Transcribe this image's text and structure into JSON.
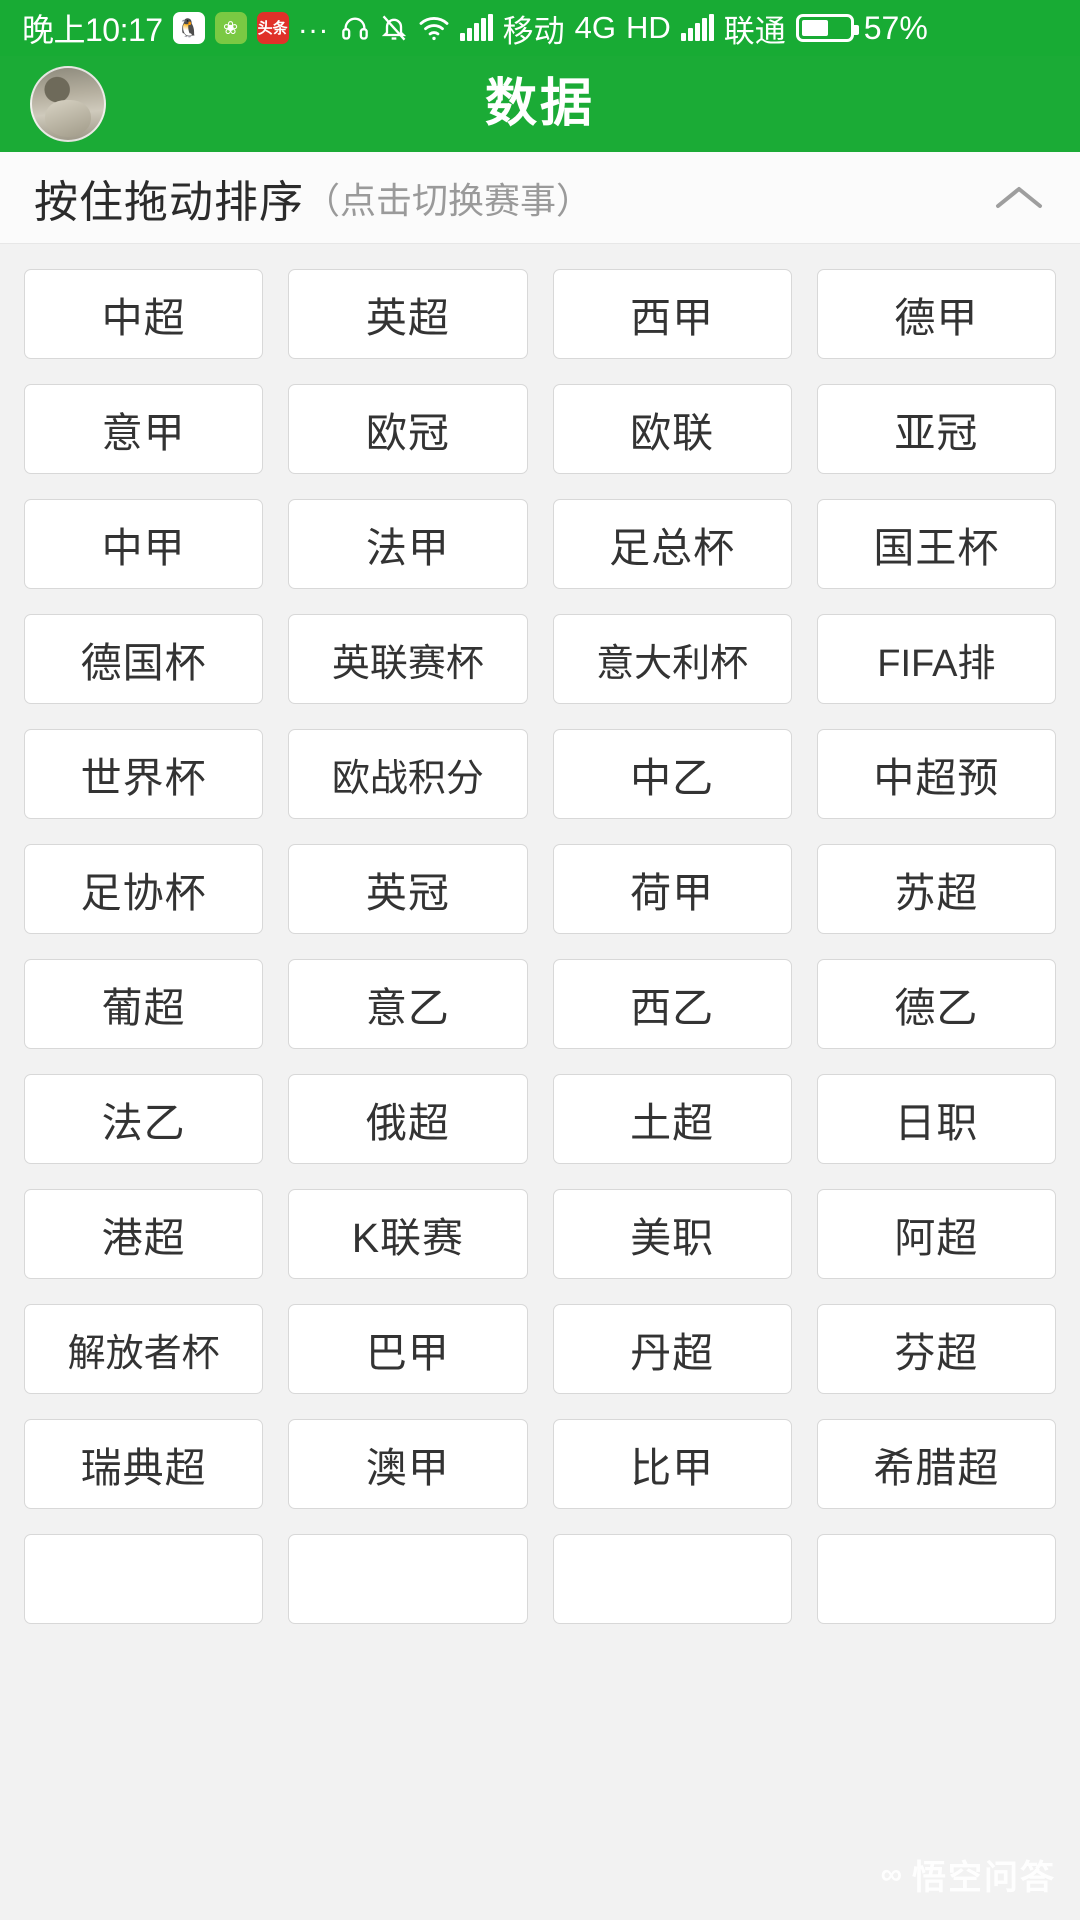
{
  "statusbar": {
    "time": "晚上10:17",
    "app_icons": [
      "qq-icon",
      "wechat-game-icon",
      "toutiao-icon"
    ],
    "overflow": "...",
    "headset_icon": "headset-icon",
    "mute_icon": "bell-muted-icon",
    "wifi_icon": "wifi-icon",
    "carrier_primary": "移动",
    "network_type": "4G",
    "hd_label": "HD",
    "carrier_secondary": "联通",
    "battery_percent": "57%",
    "battery_level": 57
  },
  "titlebar": {
    "title": "数据",
    "avatar": "user-avatar"
  },
  "subheader": {
    "main_text": "按住拖动排序",
    "hint_text": "（点击切换赛事）",
    "collapse_icon": "chevron-up-icon"
  },
  "grid": {
    "columns": 4,
    "items": [
      "中超",
      "英超",
      "西甲",
      "德甲",
      "意甲",
      "欧冠",
      "欧联",
      "亚冠",
      "中甲",
      "法甲",
      "足总杯",
      "国王杯",
      "德国杯",
      "英联赛杯",
      "意大利杯",
      "FIFA排",
      "世界杯",
      "欧战积分",
      "中乙",
      "中超预",
      "足协杯",
      "英冠",
      "荷甲",
      "苏超",
      "葡超",
      "意乙",
      "西乙",
      "德乙",
      "法乙",
      "俄超",
      "土超",
      "日职",
      "港超",
      "K联赛",
      "美职",
      "阿超",
      "解放者杯",
      "巴甲",
      "丹超",
      "芬超",
      "瑞典超",
      "澳甲",
      "比甲",
      "希腊超",
      "",
      "",
      "",
      ""
    ]
  },
  "watermark": {
    "mark": "∞",
    "text": "悟空问答"
  },
  "colors": {
    "brand_green": "#1bab36",
    "status_green": "#18ab34",
    "page_bg": "#f2f2f2",
    "card_bg": "#ffffff",
    "card_border": "#d8d8d8",
    "text_primary": "#333333",
    "text_muted": "#9a9a9a"
  }
}
